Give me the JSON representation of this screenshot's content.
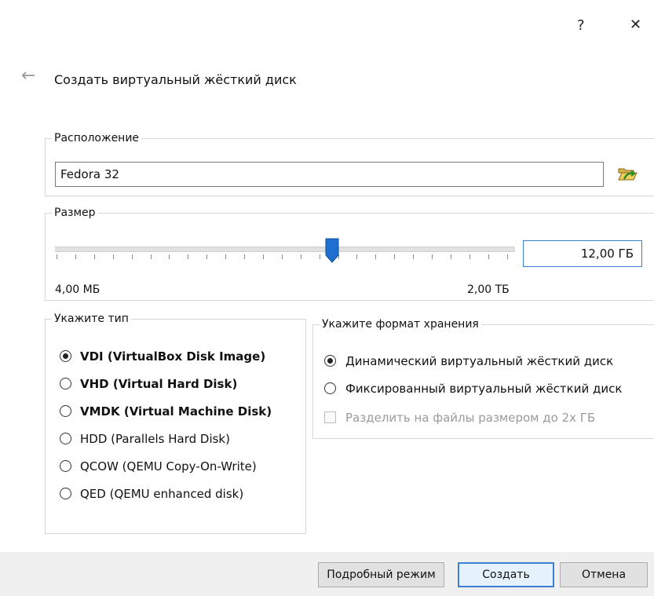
{
  "window": {
    "help_label": "?",
    "close_label": "✕",
    "back_label": "←",
    "title": "Создать виртуальный жёсткий диск"
  },
  "location": {
    "legend": "Расположение",
    "value": "Fedora 32",
    "icon": "folder-open-icon"
  },
  "size": {
    "legend": "Размер",
    "value": "12,00 ГБ",
    "min_label": "4,00 МБ",
    "max_label": "2,00 ТБ",
    "slider_level": 0.59
  },
  "type": {
    "legend": "Укажите тип",
    "options": [
      {
        "label": "VDI (VirtualBox Disk Image)",
        "selected": true,
        "bold": true
      },
      {
        "label": "VHD (Virtual Hard Disk)",
        "selected": false,
        "bold": true
      },
      {
        "label": "VMDK (Virtual Machine Disk)",
        "selected": false,
        "bold": true
      },
      {
        "label": "HDD (Parallels Hard Disk)",
        "selected": false,
        "bold": false
      },
      {
        "label": "QCOW (QEMU Copy-On-Write)",
        "selected": false,
        "bold": false
      },
      {
        "label": "QED (QEMU enhanced disk)",
        "selected": false,
        "bold": false
      }
    ]
  },
  "storage": {
    "legend": "Укажите формат хранения",
    "options": [
      {
        "label": "Динамический виртуальный жёсткий диск",
        "selected": true
      },
      {
        "label": "Фиксированный виртуальный жёсткий диск",
        "selected": false
      }
    ],
    "split_label": "Разделить на файлы размером до 2х ГБ",
    "split_checked": false
  },
  "buttons": {
    "expert": "Подробный режим",
    "create": "Создать",
    "cancel": "Отмена"
  },
  "colors": {
    "accent": "#3c7fd0",
    "slider_thumb": "#1e6fcf"
  }
}
